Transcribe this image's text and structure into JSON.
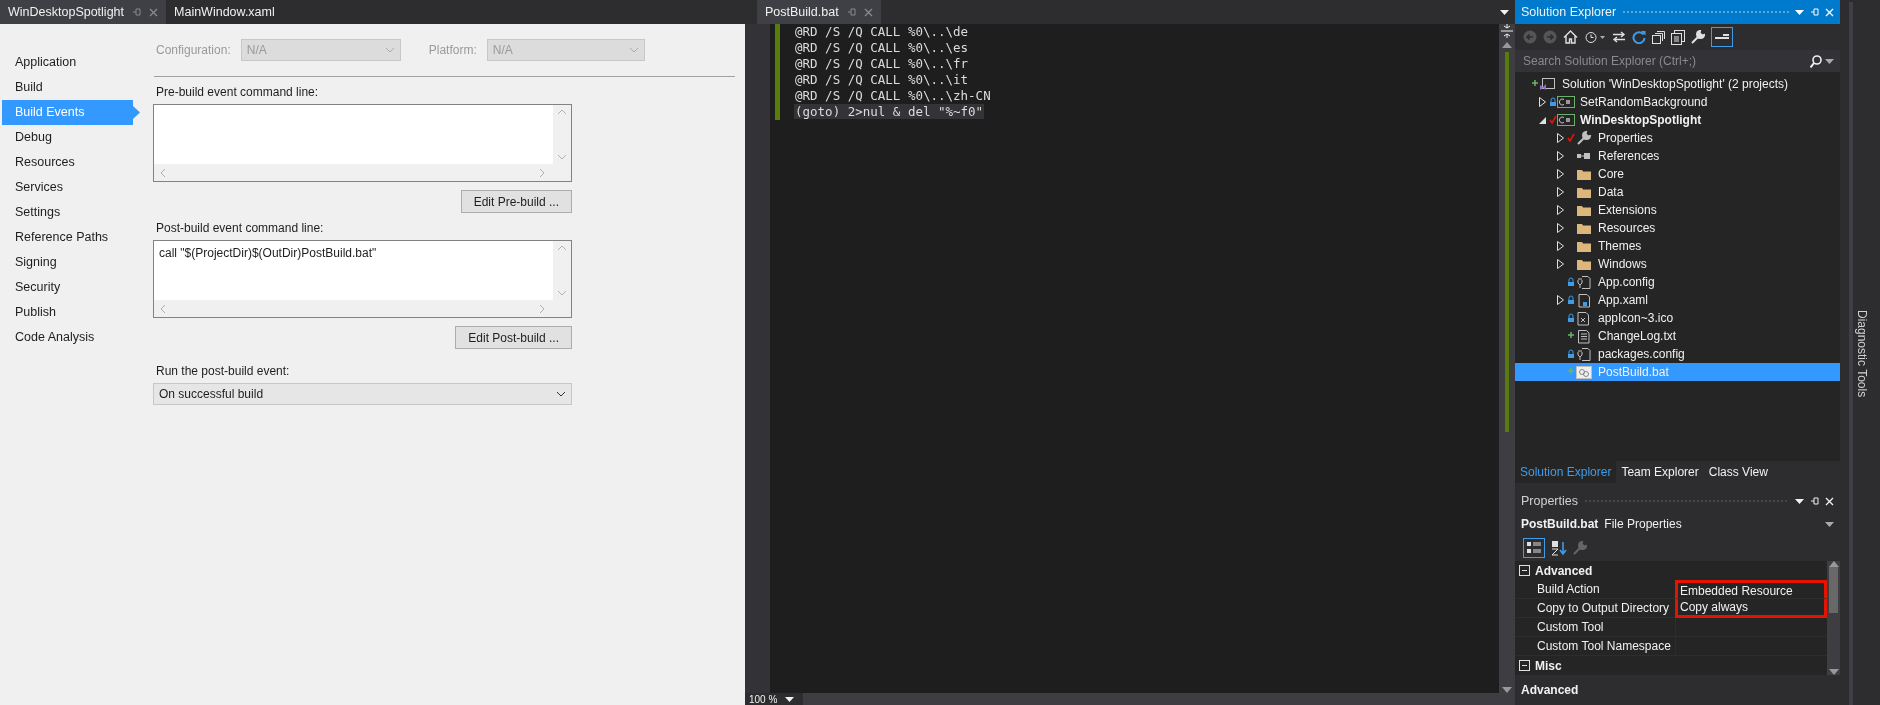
{
  "left_document": {
    "tabs": [
      {
        "label": "WinDesktopSpotlight",
        "selected": true
      },
      {
        "label": "MainWindow.xaml",
        "selected": false
      }
    ],
    "nav": [
      {
        "label": "Application",
        "selected": false
      },
      {
        "label": "Build",
        "selected": false
      },
      {
        "label": "Build Events",
        "selected": true
      },
      {
        "label": "Debug",
        "selected": false
      },
      {
        "label": "Resources",
        "selected": false
      },
      {
        "label": "Services",
        "selected": false
      },
      {
        "label": "Settings",
        "selected": false
      },
      {
        "label": "Reference Paths",
        "selected": false
      },
      {
        "label": "Signing",
        "selected": false
      },
      {
        "label": "Security",
        "selected": false
      },
      {
        "label": "Publish",
        "selected": false
      },
      {
        "label": "Code Analysis",
        "selected": false
      }
    ],
    "configuration": {
      "label": "Configuration:",
      "value": "N/A",
      "disabled": true
    },
    "platform": {
      "label": "Platform:",
      "value": "N/A",
      "disabled": true
    },
    "pre_build": {
      "label": "Pre-build event command line:",
      "button": "Edit Pre-build ..."
    },
    "post_build": {
      "label": "Post-build event command line:",
      "value": "call \"$(ProjectDir)$(OutDir)PostBuild.bat\"",
      "button": "Edit Post-build ..."
    },
    "run_post_build": {
      "label": "Run the post-build event:",
      "value": "On successful build"
    }
  },
  "editor": {
    "tab": {
      "label": "PostBuild.bat",
      "selected": true
    },
    "lines": [
      {
        "text": "@RD /S /Q CALL %0\\..\\de",
        "selected": false
      },
      {
        "text": "@RD /S /Q CALL %0\\..\\es",
        "selected": false
      },
      {
        "text": "@RD /S /Q CALL %0\\..\\fr",
        "selected": false
      },
      {
        "text": "@RD /S /Q CALL %0\\..\\it",
        "selected": false
      },
      {
        "text": "@RD /S /Q CALL %0\\..\\zh-CN",
        "selected": false
      },
      {
        "text": "(goto) 2>nul & del \"%~f0\"",
        "selected": true
      }
    ],
    "zoom": "100 %"
  },
  "solution_explorer": {
    "title": "Solution Explorer",
    "search": {
      "placeholder": "Search Solution Explorer (Ctrl+;)"
    },
    "tree": [
      {
        "label": "Solution 'WinDesktopSpotlight' (2 projects)",
        "kind": "solution",
        "added": true,
        "locked": false,
        "checked_out": false,
        "selected": false,
        "children": [
          {
            "label": "SetRandomBackground",
            "kind": "project",
            "added": false,
            "locked": true,
            "checked_out": false,
            "expanded": false,
            "startup": false,
            "selected": false
          },
          {
            "label": "WinDesktopSpotlight",
            "kind": "project",
            "added": false,
            "locked": false,
            "checked_out": true,
            "expanded": true,
            "startup": true,
            "selected": false,
            "children": [
              {
                "label": "Properties",
                "kind": "properties",
                "added": false,
                "locked": false,
                "checked_out": true,
                "expanded": false,
                "selected": false
              },
              {
                "label": "References",
                "kind": "references",
                "added": false,
                "locked": false,
                "checked_out": false,
                "expanded": false,
                "selected": false
              },
              {
                "label": "Core",
                "kind": "folder",
                "added": false,
                "locked": false,
                "checked_out": false,
                "expanded": false,
                "selected": false
              },
              {
                "label": "Data",
                "kind": "folder",
                "added": false,
                "locked": false,
                "checked_out": false,
                "expanded": false,
                "selected": false
              },
              {
                "label": "Extensions",
                "kind": "folder",
                "added": false,
                "locked": false,
                "checked_out": false,
                "expanded": false,
                "selected": false
              },
              {
                "label": "Resources",
                "kind": "folder",
                "added": false,
                "locked": false,
                "checked_out": false,
                "expanded": false,
                "selected": false
              },
              {
                "label": "Themes",
                "kind": "folder",
                "added": false,
                "locked": false,
                "checked_out": false,
                "expanded": false,
                "selected": false
              },
              {
                "label": "Windows",
                "kind": "folder",
                "added": false,
                "locked": false,
                "checked_out": false,
                "expanded": false,
                "selected": false
              },
              {
                "label": "App.config",
                "kind": "config",
                "added": false,
                "locked": true,
                "checked_out": false,
                "selected": false
              },
              {
                "label": "App.xaml",
                "kind": "xaml",
                "added": false,
                "locked": true,
                "checked_out": false,
                "expanded": false,
                "selected": false
              },
              {
                "label": "appIcon~3.ico",
                "kind": "image",
                "added": false,
                "locked": true,
                "checked_out": false,
                "selected": false
              },
              {
                "label": "ChangeLog.txt",
                "kind": "text",
                "added": true,
                "locked": false,
                "checked_out": false,
                "selected": false
              },
              {
                "label": "packages.config",
                "kind": "config",
                "added": false,
                "locked": true,
                "checked_out": false,
                "selected": false
              },
              {
                "label": "PostBuild.bat",
                "kind": "batch",
                "added": true,
                "locked": false,
                "checked_out": false,
                "selected": true
              }
            ]
          }
        ]
      }
    ],
    "tabs": [
      {
        "label": "Solution Explorer",
        "selected": true
      },
      {
        "label": "Team Explorer",
        "selected": false
      },
      {
        "label": "Class View",
        "selected": false
      }
    ]
  },
  "properties": {
    "title": "Properties",
    "object_name": "PostBuild.bat",
    "object_type": "File Properties",
    "categories": [
      {
        "name": "Advanced",
        "expanded": true,
        "rows": [
          {
            "name": "Build Action",
            "value": "Embedded Resource",
            "highlighted": true
          },
          {
            "name": "Copy to Output Directory",
            "value": "Copy always",
            "highlighted": true
          },
          {
            "name": "Custom Tool",
            "highlighted": false
          },
          {
            "name": "Custom Tool Namespace",
            "highlighted": false
          }
        ]
      },
      {
        "name": "Misc",
        "expanded": true
      }
    ],
    "description": "Advanced"
  },
  "side_tab": {
    "label": "Diagnostic Tools"
  }
}
